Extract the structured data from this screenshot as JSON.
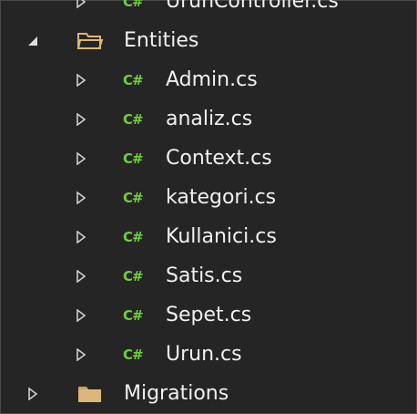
{
  "colors": {
    "background": "#252526",
    "text": "#f1f1f1",
    "csharp_icon": "#6fcf3a",
    "folder": "#dcb67a",
    "expander": "#cfcfcf"
  },
  "tree": {
    "partial_top_item": {
      "icon": "csharp-file-icon",
      "icon_text": "C#",
      "label": "UrunController.cs"
    },
    "entities_folder": {
      "icon": "folder-open-icon",
      "label": "Entities",
      "expanded": true
    },
    "entities_files": [
      {
        "icon": "csharp-file-icon",
        "icon_text": "C#",
        "label": "Admin.cs"
      },
      {
        "icon": "csharp-file-icon",
        "icon_text": "C#",
        "label": "analiz.cs"
      },
      {
        "icon": "csharp-file-icon",
        "icon_text": "C#",
        "label": "Context.cs"
      },
      {
        "icon": "csharp-file-icon",
        "icon_text": "C#",
        "label": "kategori.cs"
      },
      {
        "icon": "csharp-file-icon",
        "icon_text": "C#",
        "label": "Kullanici.cs"
      },
      {
        "icon": "csharp-file-icon",
        "icon_text": "C#",
        "label": "Satis.cs"
      },
      {
        "icon": "csharp-file-icon",
        "icon_text": "C#",
        "label": "Sepet.cs"
      },
      {
        "icon": "csharp-file-icon",
        "icon_text": "C#",
        "label": "Urun.cs"
      }
    ],
    "migrations_folder": {
      "icon": "folder-closed-icon",
      "label": "Migrations",
      "expanded": false
    }
  }
}
